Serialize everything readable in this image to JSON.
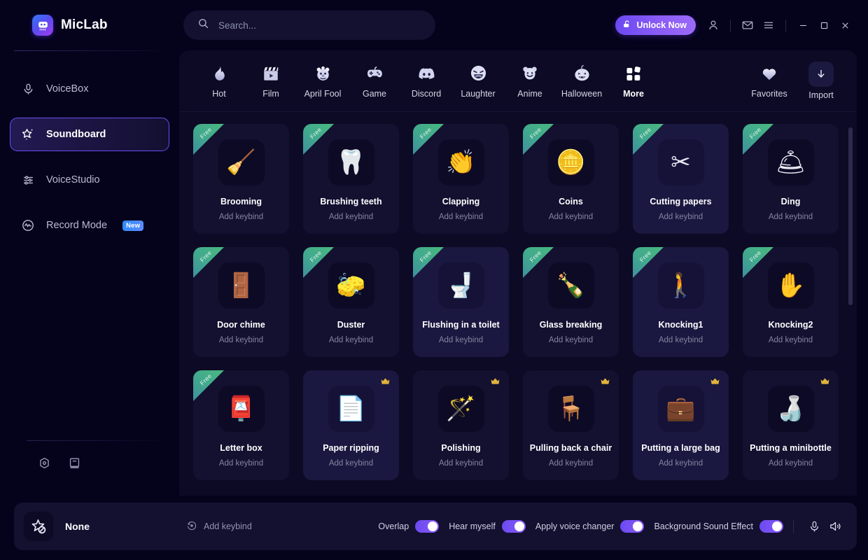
{
  "app": {
    "name": "MicLab",
    "logo_icon": "robot-logo-icon"
  },
  "search": {
    "placeholder": "Search...",
    "value": "",
    "icon": "search-icon"
  },
  "titlebar": {
    "unlock_label": "Unlock Now",
    "unlock_icon": "lock-open-icon",
    "account_icon": "user-icon",
    "mail_icon": "mail-icon",
    "menu_icon": "hamburger-menu-icon",
    "minimize_icon": "minimize-icon",
    "maximize_icon": "maximize-icon",
    "close_icon": "close-icon"
  },
  "sidebar": {
    "items": [
      {
        "label": "VoiceBox",
        "icon": "microphone-icon",
        "active": false,
        "badge": ""
      },
      {
        "label": "Soundboard",
        "icon": "magic-star-icon",
        "active": true,
        "badge": ""
      },
      {
        "label": "VoiceStudio",
        "icon": "sliders-icon",
        "active": false,
        "badge": ""
      },
      {
        "label": "Record Mode",
        "icon": "waveform-circle-icon",
        "active": false,
        "badge": "New"
      }
    ],
    "bottom_icons": [
      {
        "name": "settings-gear-icon"
      },
      {
        "name": "guide-book-icon"
      }
    ]
  },
  "categories": {
    "items": [
      {
        "label": "Hot",
        "icon": "fire-icon",
        "selected": false
      },
      {
        "label": "Film",
        "icon": "clapperboard-icon",
        "selected": false
      },
      {
        "label": "April Fool",
        "icon": "clown-icon",
        "selected": false
      },
      {
        "label": "Game",
        "icon": "gamepad-icon",
        "selected": false
      },
      {
        "label": "Discord",
        "icon": "discord-icon",
        "selected": false
      },
      {
        "label": "Laughter",
        "icon": "laughing-face-icon",
        "selected": false
      },
      {
        "label": "Anime",
        "icon": "bear-face-icon",
        "selected": false
      },
      {
        "label": "Halloween",
        "icon": "pumpkin-icon",
        "selected": false
      },
      {
        "label": "More",
        "icon": "grid-squares-icon",
        "selected": true
      }
    ],
    "right_items": [
      {
        "label": "Favorites",
        "icon": "heart-icon"
      },
      {
        "label": "Import",
        "icon": "download-arrow-icon"
      }
    ]
  },
  "sounds": {
    "keybind_label": "Add keybind",
    "free_ribbon": "Free",
    "items": [
      {
        "title": "Brooming",
        "art": "🧹",
        "tag": "free",
        "hover": false
      },
      {
        "title": "Brushing teeth",
        "art": "🦷",
        "tag": "free",
        "hover": false
      },
      {
        "title": "Clapping",
        "art": "👏",
        "tag": "free",
        "hover": false
      },
      {
        "title": "Coins",
        "art": "🪙",
        "tag": "free",
        "hover": false
      },
      {
        "title": "Cutting papers",
        "art": "✂",
        "tag": "free",
        "hover": true
      },
      {
        "title": "Ding",
        "art": "🛎",
        "tag": "free",
        "hover": false
      },
      {
        "title": "Door chime",
        "art": "🚪",
        "tag": "free",
        "hover": false
      },
      {
        "title": "Duster",
        "art": "🧽",
        "tag": "free",
        "hover": false
      },
      {
        "title": "Flushing in a toilet",
        "art": "🚽",
        "tag": "free",
        "hover": true
      },
      {
        "title": "Glass breaking",
        "art": "🍾",
        "tag": "free",
        "hover": false
      },
      {
        "title": "Knocking1",
        "art": "🚶",
        "tag": "free",
        "hover": true
      },
      {
        "title": "Knocking2",
        "art": "✋",
        "tag": "free",
        "hover": false
      },
      {
        "title": "Letter box",
        "art": "📮",
        "tag": "free",
        "hover": false
      },
      {
        "title": "Paper ripping",
        "art": "📄",
        "tag": "crown",
        "hover": true
      },
      {
        "title": "Polishing",
        "art": "🪄",
        "tag": "crown",
        "hover": false
      },
      {
        "title": "Pulling back a chair",
        "art": "🪑",
        "tag": "crown",
        "hover": false
      },
      {
        "title": "Putting a large bag",
        "art": "💼",
        "tag": "crown",
        "hover": true
      },
      {
        "title": "Putting a minibottle",
        "art": "🍶",
        "tag": "crown",
        "hover": false
      }
    ]
  },
  "player": {
    "current_sound": "None",
    "current_sound_icon": "star-disabled-icon",
    "add_keybind_label": "Add keybind",
    "add_keybind_icon": "rotate-record-icon",
    "toggles": [
      {
        "label": "Overlap",
        "on": true
      },
      {
        "label": "Hear myself",
        "on": true
      },
      {
        "label": "Apply voice changer",
        "on": true
      },
      {
        "label": "Background Sound Effect",
        "on": true
      }
    ],
    "mic_icon": "microphone-icon",
    "speaker_icon": "speaker-icon"
  },
  "colors": {
    "accent": "#7c4ff3",
    "panel": "#0c0a24",
    "card": "#131030",
    "free_ribbon": "#41a98e",
    "crown": "#e2b33c",
    "new_badge": "#2f8bf8"
  }
}
